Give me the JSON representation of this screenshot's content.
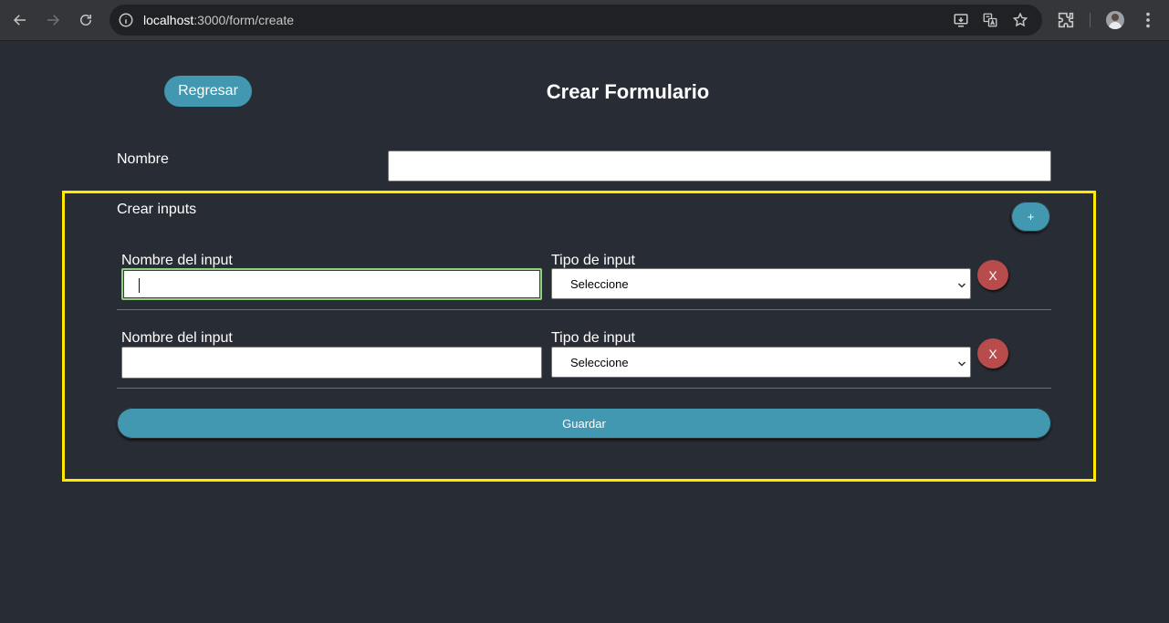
{
  "browser": {
    "url_host": "localhost",
    "url_rest": ":3000/form/create"
  },
  "page": {
    "back_label": "Regresar",
    "title": "Crear Formulario",
    "nombre_label": "Nombre",
    "nombre_value": "",
    "inputs_section_label": "Crear inputs",
    "add_label": "+",
    "save_label": "Guardar"
  },
  "input_rows": [
    {
      "name_label": "Nombre del input",
      "name_value": "",
      "type_label": "Tipo de input",
      "type_value": "Seleccione",
      "delete_label": "X"
    },
    {
      "name_label": "Nombre del input",
      "name_value": "",
      "type_label": "Tipo de input",
      "type_value": "Seleccione",
      "delete_label": "X"
    }
  ],
  "colors": {
    "page_background": "#282c34",
    "accent": "#4198b0",
    "danger": "#b84b4b",
    "highlight_border": "#ffea00",
    "focus_border": "#8fd17d"
  }
}
